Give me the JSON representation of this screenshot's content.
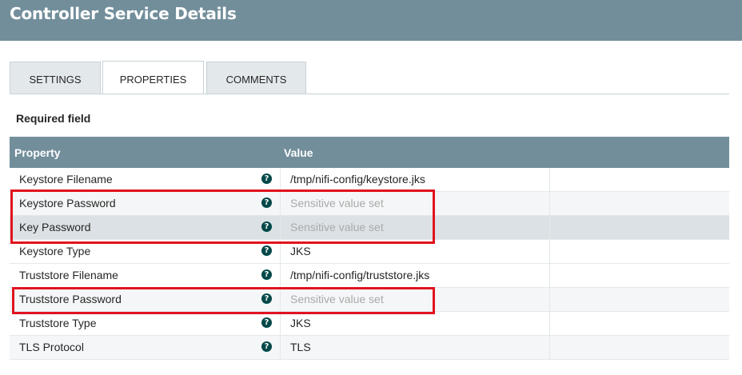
{
  "header": {
    "title": "Controller Service Details"
  },
  "tabs": [
    {
      "label": "SETTINGS",
      "active": false
    },
    {
      "label": "PROPERTIES",
      "active": true
    },
    {
      "label": "COMMENTS",
      "active": false
    }
  ],
  "required_label": "Required field",
  "table": {
    "columns": {
      "property": "Property",
      "value": "Value"
    },
    "rows": [
      {
        "name": "Keystore Filename",
        "value": "/tmp/nifi-config/keystore.jks",
        "sensitive": false
      },
      {
        "name": "Keystore Password",
        "value": "Sensitive value set",
        "sensitive": true
      },
      {
        "name": "Key Password",
        "value": "Sensitive value set",
        "sensitive": true
      },
      {
        "name": "Keystore Type",
        "value": "JKS",
        "sensitive": false
      },
      {
        "name": "Truststore Filename",
        "value": "/tmp/nifi-config/truststore.jks",
        "sensitive": false
      },
      {
        "name": "Truststore Password",
        "value": "Sensitive value set",
        "sensitive": true
      },
      {
        "name": "Truststore Type",
        "value": "JKS",
        "sensitive": false
      },
      {
        "name": "TLS Protocol",
        "value": "TLS",
        "sensitive": false
      }
    ]
  },
  "help_glyph": "?",
  "colors": {
    "header": "#728e9b",
    "highlight": "#e0141e",
    "help_icon": "#004849"
  }
}
